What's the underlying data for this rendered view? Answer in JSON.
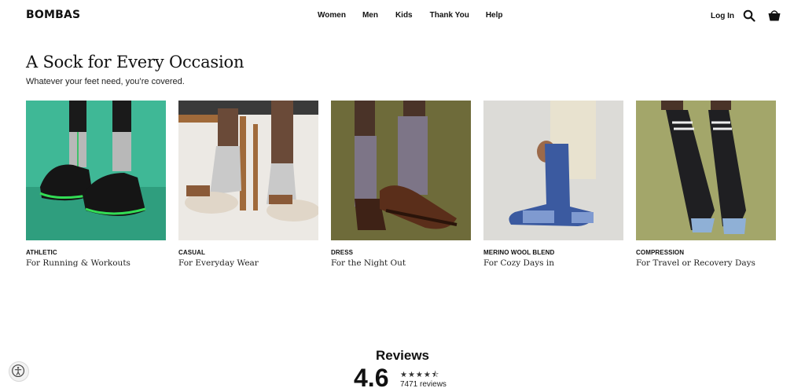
{
  "brand": {
    "logo": "BOMBAS"
  },
  "nav": {
    "items": [
      {
        "label": "Women"
      },
      {
        "label": "Men"
      },
      {
        "label": "Kids"
      },
      {
        "label": "Thank You"
      },
      {
        "label": "Help"
      }
    ],
    "login": "Log In",
    "icons": [
      "search-icon",
      "cart-icon"
    ]
  },
  "section": {
    "title": "A Sock for Every Occasion",
    "subtitle": "Whatever your feet need, you’re covered."
  },
  "cards": [
    {
      "category": "ATHLETIC",
      "description": "For Running & Workouts",
      "background": "#3fb896",
      "sock_color": "#b8b8b8"
    },
    {
      "category": "CASUAL",
      "description": "For Everyday Wear",
      "background": "#ece9e4",
      "sock_color": "#c9c9c9"
    },
    {
      "category": "DRESS",
      "description": "For the Night Out",
      "background": "#6e6b3a",
      "sock_color": "#7d7587"
    },
    {
      "category": "MERINO WOOL BLEND",
      "description": "For Cozy Days in",
      "background": "#dcdbd7",
      "sock_color": "#3b5aa0"
    },
    {
      "category": "COMPRESSION",
      "description": "For Travel or Recovery Days",
      "background": "#a3a66a",
      "sock_color": "#1f1f22"
    }
  ],
  "reviews": {
    "title": "Reviews",
    "rating": "4.6",
    "stars": "★★★★⯪",
    "count": "7471 reviews"
  }
}
